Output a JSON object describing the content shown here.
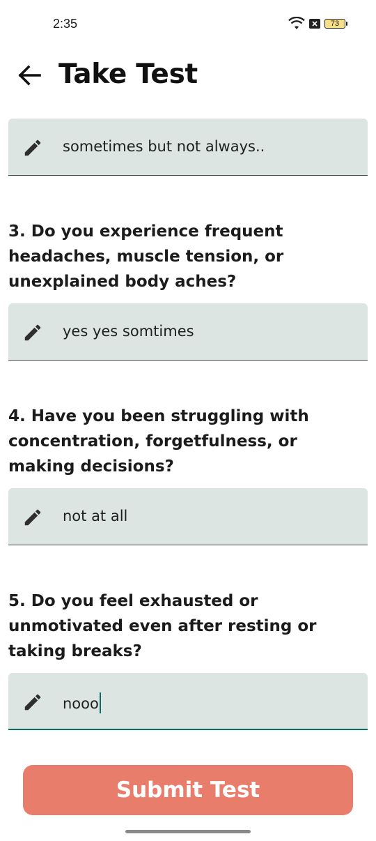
{
  "status_bar": {
    "time": "2:35",
    "battery_level": "73",
    "icons": [
      "wifi-icon",
      "close-box-icon",
      "battery-icon"
    ]
  },
  "app_bar": {
    "title": "Take Test",
    "back_icon": "arrow-left-icon"
  },
  "questions": [
    {
      "answer": "sometimes but not always.."
    },
    {
      "number_label": "3. Do you experience frequent headaches, muscle tension, or unexplained body aches?",
      "answer": "yes yes somtimes"
    },
    {
      "number_label": "4. Have you been struggling with concentration, forgetfulness, or making decisions?",
      "answer": "not at all"
    },
    {
      "number_label": "5. Do you feel exhausted or unmotivated even after resting or taking breaks?",
      "answer": "nooo"
    }
  ],
  "submit": {
    "label": "Submit Test"
  },
  "colors": {
    "field_bg": "#dce5e2",
    "active_underline": "#0f6a5f",
    "submit_bg": "#e97d6b"
  }
}
